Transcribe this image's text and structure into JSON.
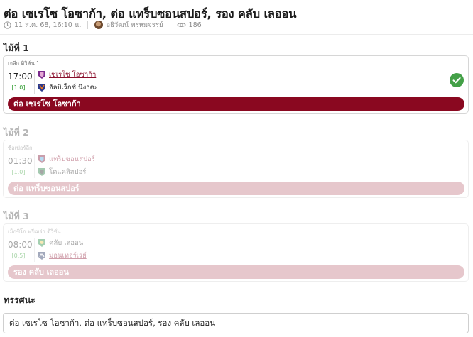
{
  "article": {
    "title": "ต่อ เซเรโซ โอซาก้า, ต่อ แทร็บซอนสปอร์, รอง คลับ เลออน",
    "date": "11 ส.ค. 68, 16:10 น.",
    "author": "อธิวัฒน์ พรหมจรรย์",
    "views": "186"
  },
  "picks": [
    {
      "label": "ไม้ที่ 1",
      "league": "เจลีก ดิวิชั่น 1",
      "time": "17:00",
      "handicap": "[1.0]",
      "home": "เซเรโซ โอซาก้า",
      "away": "อัลบิเร็กซ์ นิงาตะ",
      "highlighted": "home",
      "selection": "ต่อ เซเรโซ โอซาก้า",
      "result_icon": "check-circle-icon",
      "status": "won"
    },
    {
      "label": "ไม้ที่ 2",
      "league": "ซือเปอร์ลีก",
      "time": "01:30",
      "handicap": "[1.0]",
      "home": "แทร็บซอนสปอร์",
      "away": "โคแคลิสปอร์",
      "highlighted": "home",
      "selection": "ต่อ แทร็บซอนสปอร์",
      "status": "pending"
    },
    {
      "label": "ไม้ที่ 3",
      "league": "เม็กซิโก พรีเมร่า ดิวิชั่น",
      "time": "08:00",
      "handicap": "[0.5]",
      "home": "คลับ เลออน",
      "away": "มอนเทอร์เรย์",
      "highlighted": "away",
      "selection": "รอง คลับ เลออน",
      "status": "pending"
    }
  ],
  "summary": {
    "heading": "ทรรศนะ",
    "text": "ต่อ เซเรโซ โอซาก้า, ต่อ แทร็บซอนสปอร์, รอง คลับ เลออน"
  },
  "colors": {
    "accent": "#8a0820",
    "accent_pale": "#c27582",
    "handicap": "#2c9a2c",
    "won": "#43a047"
  }
}
